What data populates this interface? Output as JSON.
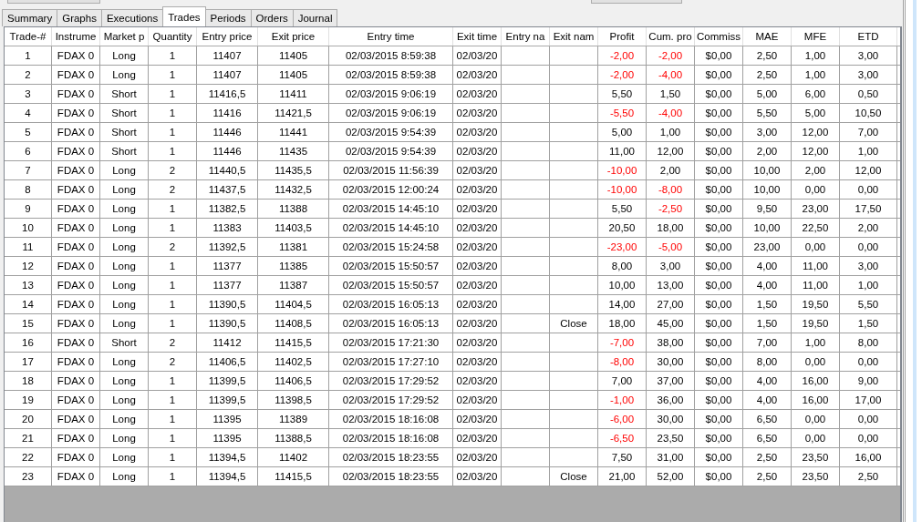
{
  "tabs": [
    {
      "label": "Summary",
      "selected": false
    },
    {
      "label": "Graphs",
      "selected": false
    },
    {
      "label": "Executions",
      "selected": false
    },
    {
      "label": "Trades",
      "selected": true
    },
    {
      "label": "Periods",
      "selected": false
    },
    {
      "label": "Orders",
      "selected": false
    },
    {
      "label": "Journal",
      "selected": false
    }
  ],
  "table": {
    "columns": [
      "Trade-#",
      "Instrume",
      "Market p",
      "Quantity",
      "Entry price",
      "Exit price",
      "Entry time",
      "Exit time",
      "Entry na",
      "Exit nam",
      "Profit",
      "Cum. pro",
      "Commiss",
      "MAE",
      "MFE",
      "ETD"
    ],
    "rows": [
      {
        "id": "1",
        "instrument": "FDAX 0",
        "position": "Long",
        "qty": "1",
        "entry_price": "11407",
        "exit_price": "11405",
        "entry_time": "02/03/2015 8:59:38",
        "exit_time": "02/03/20",
        "profit": "-2,00",
        "profit_loss": true,
        "cum": "-2,00",
        "cum_loss": true,
        "commission": "$0,00",
        "mae": "2,50",
        "mfe": "1,00",
        "etd": "3,00"
      },
      {
        "id": "2",
        "instrument": "FDAX 0",
        "position": "Long",
        "qty": "1",
        "entry_price": "11407",
        "exit_price": "11405",
        "entry_time": "02/03/2015 8:59:38",
        "exit_time": "02/03/20",
        "profit": "-2,00",
        "profit_loss": true,
        "cum": "-4,00",
        "cum_loss": true,
        "commission": "$0,00",
        "mae": "2,50",
        "mfe": "1,00",
        "etd": "3,00"
      },
      {
        "id": "3",
        "instrument": "FDAX 0",
        "position": "Short",
        "qty": "1",
        "entry_price": "11416,5",
        "exit_price": "11411",
        "entry_time": "02/03/2015 9:06:19",
        "exit_time": "02/03/20",
        "profit": "5,50",
        "profit_loss": false,
        "cum": "1,50",
        "cum_loss": false,
        "commission": "$0,00",
        "mae": "5,00",
        "mfe": "6,00",
        "etd": "0,50"
      },
      {
        "id": "4",
        "instrument": "FDAX 0",
        "position": "Short",
        "qty": "1",
        "entry_price": "11416",
        "exit_price": "11421,5",
        "entry_time": "02/03/2015 9:06:19",
        "exit_time": "02/03/20",
        "profit": "-5,50",
        "profit_loss": true,
        "cum": "-4,00",
        "cum_loss": true,
        "commission": "$0,00",
        "mae": "5,50",
        "mfe": "5,00",
        "etd": "10,50"
      },
      {
        "id": "5",
        "instrument": "FDAX 0",
        "position": "Short",
        "qty": "1",
        "entry_price": "11446",
        "exit_price": "11441",
        "entry_time": "02/03/2015 9:54:39",
        "exit_time": "02/03/20",
        "profit": "5,00",
        "profit_loss": false,
        "cum": "1,00",
        "cum_loss": false,
        "commission": "$0,00",
        "mae": "3,00",
        "mfe": "12,00",
        "etd": "7,00"
      },
      {
        "id": "6",
        "instrument": "FDAX 0",
        "position": "Short",
        "qty": "1",
        "entry_price": "11446",
        "exit_price": "11435",
        "entry_time": "02/03/2015 9:54:39",
        "exit_time": "02/03/20",
        "profit": "11,00",
        "profit_loss": false,
        "cum": "12,00",
        "cum_loss": false,
        "commission": "$0,00",
        "mae": "2,00",
        "mfe": "12,00",
        "etd": "1,00"
      },
      {
        "id": "7",
        "instrument": "FDAX 0",
        "position": "Long",
        "qty": "2",
        "entry_price": "11440,5",
        "exit_price": "11435,5",
        "entry_time": "02/03/2015 11:56:39",
        "exit_time": "02/03/20",
        "profit": "-10,00",
        "profit_loss": true,
        "cum": "2,00",
        "cum_loss": false,
        "commission": "$0,00",
        "mae": "10,00",
        "mfe": "2,00",
        "etd": "12,00"
      },
      {
        "id": "8",
        "instrument": "FDAX 0",
        "position": "Long",
        "qty": "2",
        "entry_price": "11437,5",
        "exit_price": "11432,5",
        "entry_time": "02/03/2015 12:00:24",
        "exit_time": "02/03/20",
        "profit": "-10,00",
        "profit_loss": true,
        "cum": "-8,00",
        "cum_loss": true,
        "commission": "$0,00",
        "mae": "10,00",
        "mfe": "0,00",
        "etd": "0,00"
      },
      {
        "id": "9",
        "instrument": "FDAX 0",
        "position": "Long",
        "qty": "1",
        "entry_price": "11382,5",
        "exit_price": "11388",
        "entry_time": "02/03/2015 14:45:10",
        "exit_time": "02/03/20",
        "profit": "5,50",
        "profit_loss": false,
        "cum": "-2,50",
        "cum_loss": true,
        "commission": "$0,00",
        "mae": "9,50",
        "mfe": "23,00",
        "etd": "17,50"
      },
      {
        "id": "10",
        "instrument": "FDAX 0",
        "position": "Long",
        "qty": "1",
        "entry_price": "11383",
        "exit_price": "11403,5",
        "entry_time": "02/03/2015 14:45:10",
        "exit_time": "02/03/20",
        "profit": "20,50",
        "profit_loss": false,
        "cum": "18,00",
        "cum_loss": false,
        "commission": "$0,00",
        "mae": "10,00",
        "mfe": "22,50",
        "etd": "2,00"
      },
      {
        "id": "11",
        "instrument": "FDAX 0",
        "position": "Long",
        "qty": "2",
        "entry_price": "11392,5",
        "exit_price": "11381",
        "entry_time": "02/03/2015 15:24:58",
        "exit_time": "02/03/20",
        "profit": "-23,00",
        "profit_loss": true,
        "cum": "-5,00",
        "cum_loss": true,
        "commission": "$0,00",
        "mae": "23,00",
        "mfe": "0,00",
        "etd": "0,00"
      },
      {
        "id": "12",
        "instrument": "FDAX 0",
        "position": "Long",
        "qty": "1",
        "entry_price": "11377",
        "exit_price": "11385",
        "entry_time": "02/03/2015 15:50:57",
        "exit_time": "02/03/20",
        "profit": "8,00",
        "profit_loss": false,
        "cum": "3,00",
        "cum_loss": false,
        "commission": "$0,00",
        "mae": "4,00",
        "mfe": "11,00",
        "etd": "3,00"
      },
      {
        "id": "13",
        "instrument": "FDAX 0",
        "position": "Long",
        "qty": "1",
        "entry_price": "11377",
        "exit_price": "11387",
        "entry_time": "02/03/2015 15:50:57",
        "exit_time": "02/03/20",
        "profit": "10,00",
        "profit_loss": false,
        "cum": "13,00",
        "cum_loss": false,
        "commission": "$0,00",
        "mae": "4,00",
        "mfe": "11,00",
        "etd": "1,00"
      },
      {
        "id": "14",
        "instrument": "FDAX 0",
        "position": "Long",
        "qty": "1",
        "entry_price": "11390,5",
        "exit_price": "11404,5",
        "entry_time": "02/03/2015 16:05:13",
        "exit_time": "02/03/20",
        "profit": "14,00",
        "profit_loss": false,
        "cum": "27,00",
        "cum_loss": false,
        "commission": "$0,00",
        "mae": "1,50",
        "mfe": "19,50",
        "etd": "5,50"
      },
      {
        "id": "15",
        "instrument": "FDAX 0",
        "position": "Long",
        "qty": "1",
        "entry_price": "11390,5",
        "exit_price": "11408,5",
        "entry_time": "02/03/2015 16:05:13",
        "exit_time": "02/03/20",
        "exit_name": "Close",
        "profit": "18,00",
        "profit_loss": false,
        "cum": "45,00",
        "cum_loss": false,
        "commission": "$0,00",
        "mae": "1,50",
        "mfe": "19,50",
        "etd": "1,50"
      },
      {
        "id": "16",
        "instrument": "FDAX 0",
        "position": "Short",
        "qty": "2",
        "entry_price": "11412",
        "exit_price": "11415,5",
        "entry_time": "02/03/2015 17:21:30",
        "exit_time": "02/03/20",
        "profit": "-7,00",
        "profit_loss": true,
        "cum": "38,00",
        "cum_loss": false,
        "commission": "$0,00",
        "mae": "7,00",
        "mfe": "1,00",
        "etd": "8,00"
      },
      {
        "id": "17",
        "instrument": "FDAX 0",
        "position": "Long",
        "qty": "2",
        "entry_price": "11406,5",
        "exit_price": "11402,5",
        "entry_time": "02/03/2015 17:27:10",
        "exit_time": "02/03/20",
        "profit": "-8,00",
        "profit_loss": true,
        "cum": "30,00",
        "cum_loss": false,
        "commission": "$0,00",
        "mae": "8,00",
        "mfe": "0,00",
        "etd": "0,00"
      },
      {
        "id": "18",
        "instrument": "FDAX 0",
        "position": "Long",
        "qty": "1",
        "entry_price": "11399,5",
        "exit_price": "11406,5",
        "entry_time": "02/03/2015 17:29:52",
        "exit_time": "02/03/20",
        "profit": "7,00",
        "profit_loss": false,
        "cum": "37,00",
        "cum_loss": false,
        "commission": "$0,00",
        "mae": "4,00",
        "mfe": "16,00",
        "etd": "9,00"
      },
      {
        "id": "19",
        "instrument": "FDAX 0",
        "position": "Long",
        "qty": "1",
        "entry_price": "11399,5",
        "exit_price": "11398,5",
        "entry_time": "02/03/2015 17:29:52",
        "exit_time": "02/03/20",
        "profit": "-1,00",
        "profit_loss": true,
        "cum": "36,00",
        "cum_loss": false,
        "commission": "$0,00",
        "mae": "4,00",
        "mfe": "16,00",
        "etd": "17,00"
      },
      {
        "id": "20",
        "instrument": "FDAX 0",
        "position": "Long",
        "qty": "1",
        "entry_price": "11395",
        "exit_price": "11389",
        "entry_time": "02/03/2015 18:16:08",
        "exit_time": "02/03/20",
        "profit": "-6,00",
        "profit_loss": true,
        "cum": "30,00",
        "cum_loss": false,
        "commission": "$0,00",
        "mae": "6,50",
        "mfe": "0,00",
        "etd": "0,00"
      },
      {
        "id": "21",
        "instrument": "FDAX 0",
        "position": "Long",
        "qty": "1",
        "entry_price": "11395",
        "exit_price": "11388,5",
        "entry_time": "02/03/2015 18:16:08",
        "exit_time": "02/03/20",
        "profit": "-6,50",
        "profit_loss": true,
        "cum": "23,50",
        "cum_loss": false,
        "commission": "$0,00",
        "mae": "6,50",
        "mfe": "0,00",
        "etd": "0,00"
      },
      {
        "id": "22",
        "instrument": "FDAX 0",
        "position": "Long",
        "qty": "1",
        "entry_price": "11394,5",
        "exit_price": "11402",
        "entry_time": "02/03/2015 18:23:55",
        "exit_time": "02/03/20",
        "profit": "7,50",
        "profit_loss": false,
        "cum": "31,00",
        "cum_loss": false,
        "commission": "$0,00",
        "mae": "2,50",
        "mfe": "23,50",
        "etd": "16,00"
      },
      {
        "id": "23",
        "instrument": "FDAX 0",
        "position": "Long",
        "qty": "1",
        "entry_price": "11394,5",
        "exit_price": "11415,5",
        "entry_time": "02/03/2015 18:23:55",
        "exit_time": "02/03/20",
        "exit_name": "Close",
        "profit": "21,00",
        "profit_loss": false,
        "cum": "52,00",
        "cum_loss": false,
        "commission": "$0,00",
        "mae": "2,50",
        "mfe": "23,50",
        "etd": "2,50"
      }
    ]
  }
}
